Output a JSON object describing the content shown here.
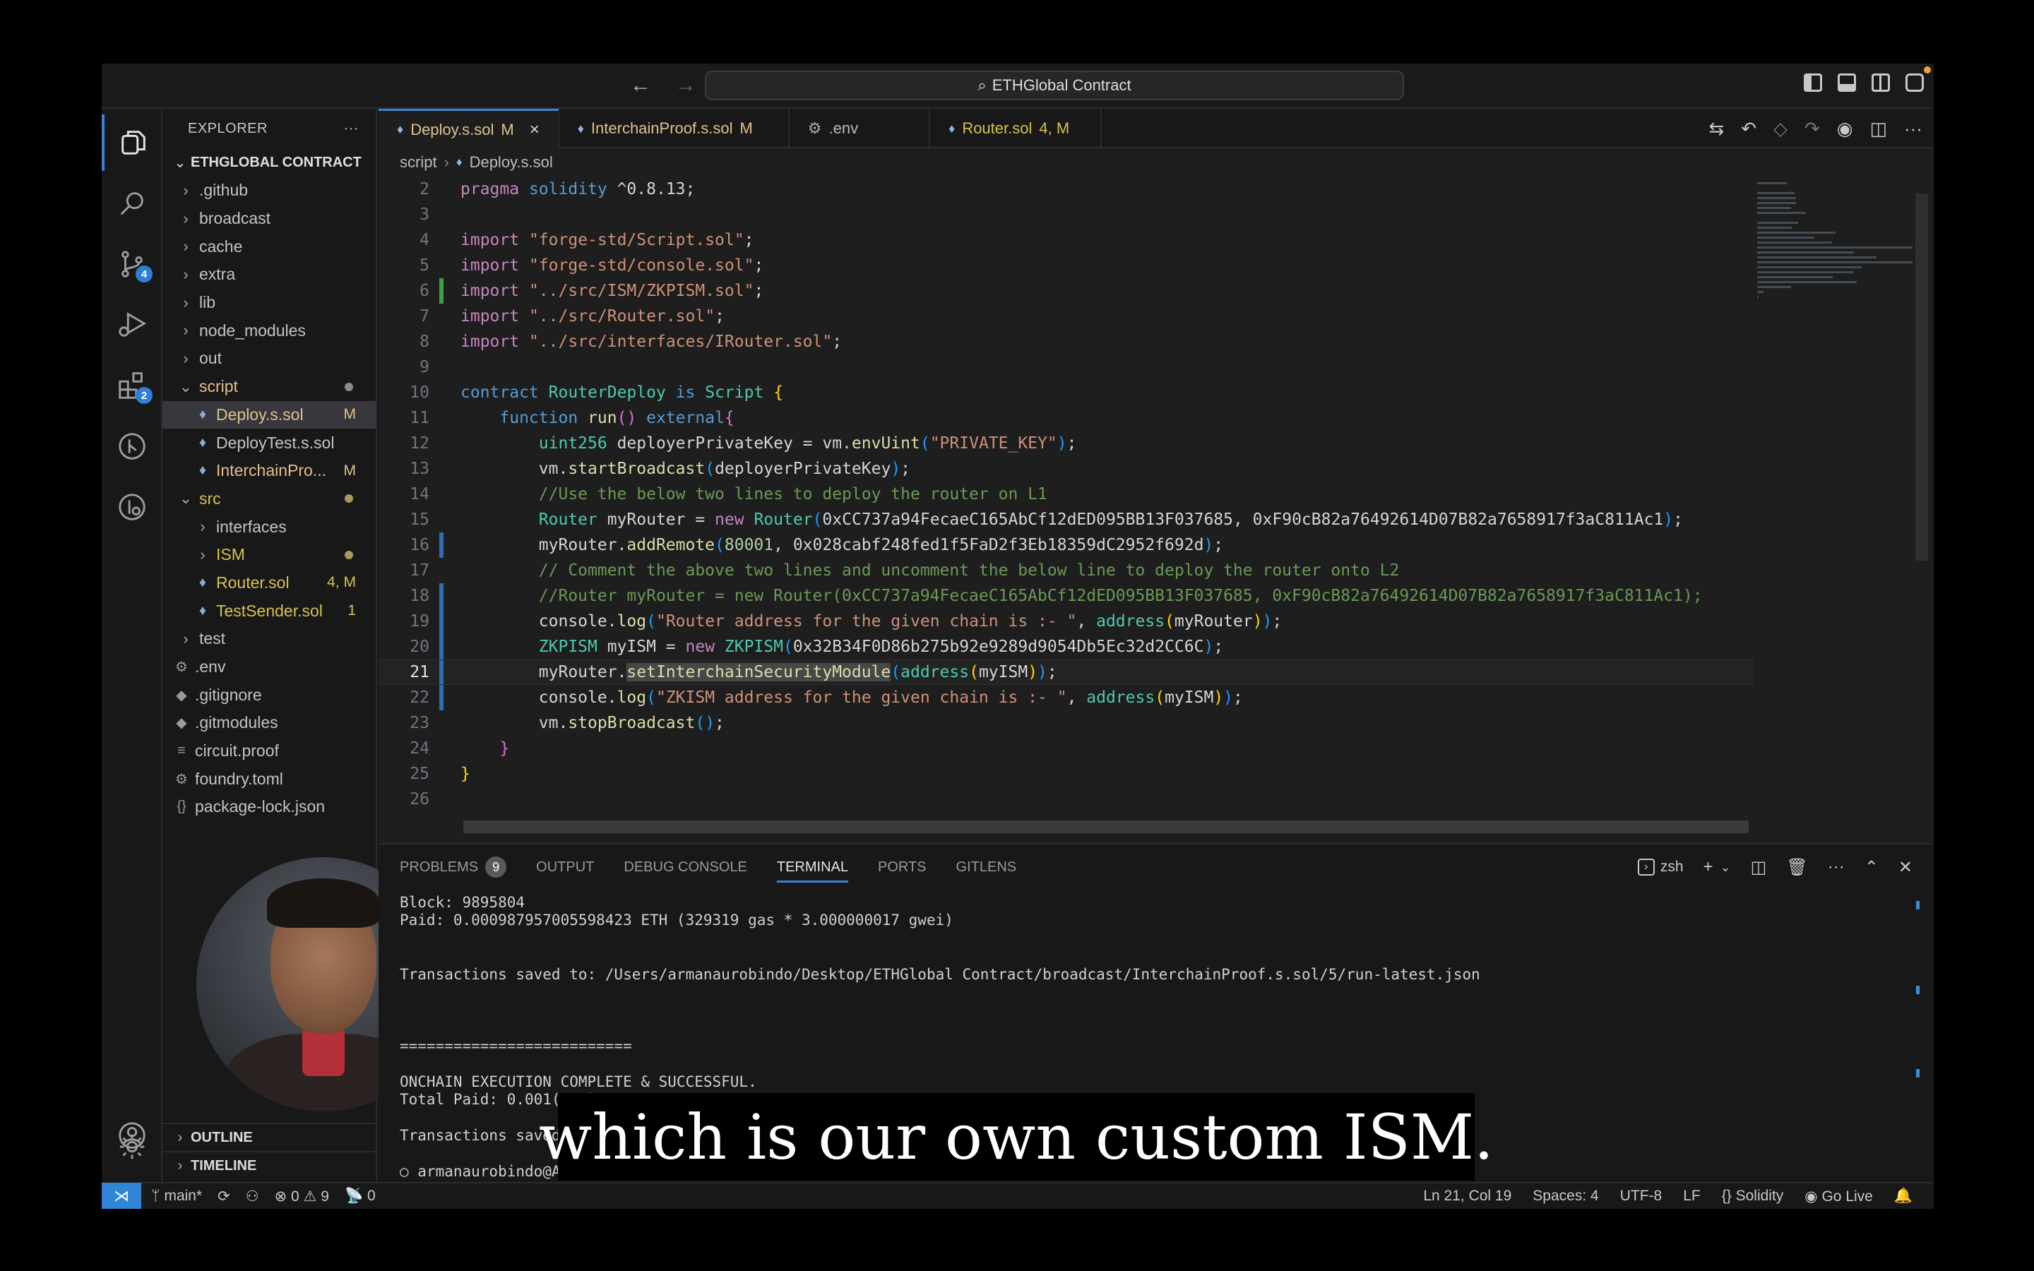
{
  "titlebar": {
    "back_icon": "arrow-left",
    "forward_icon": "arrow-right",
    "search_text": "ETHGlobal Contract",
    "layout_icons": [
      "toggle-primary-sidebar",
      "toggle-panel",
      "toggle-secondary-sidebar",
      "customize-layout"
    ]
  },
  "activity_bar": {
    "items": [
      {
        "name": "explorer",
        "active": true
      },
      {
        "name": "search"
      },
      {
        "name": "source-control",
        "badge": "4"
      },
      {
        "name": "run-and-debug"
      },
      {
        "name": "extensions",
        "badge": "2"
      },
      {
        "name": "gitlens"
      },
      {
        "name": "gitlens-inspect"
      }
    ],
    "bottom": [
      "accounts",
      "manage"
    ]
  },
  "sidebar": {
    "title": "EXPLORER",
    "more": "···",
    "root": "ETHGLOBAL CONTRACT",
    "tree": [
      {
        "label": ".github",
        "type": "folder",
        "depth": 1
      },
      {
        "label": "broadcast",
        "type": "folder",
        "depth": 1
      },
      {
        "label": "cache",
        "type": "folder",
        "depth": 1
      },
      {
        "label": "extra",
        "type": "folder",
        "depth": 1
      },
      {
        "label": "lib",
        "type": "folder",
        "depth": 1
      },
      {
        "label": "node_modules",
        "type": "folder",
        "depth": 1
      },
      {
        "label": "out",
        "type": "folder",
        "depth": 1
      },
      {
        "label": "script",
        "type": "folder-open",
        "depth": 1,
        "dot": true
      },
      {
        "label": "Deploy.s.sol",
        "type": "sol",
        "depth": 2,
        "status": "M",
        "selected": true
      },
      {
        "label": "DeployTest.s.sol",
        "type": "sol",
        "depth": 2
      },
      {
        "label": "InterchainPro...",
        "type": "sol",
        "depth": 2,
        "status": "M"
      },
      {
        "label": "src",
        "type": "folder-open",
        "depth": 1,
        "dot": true
      },
      {
        "label": "interfaces",
        "type": "folder",
        "depth": 2
      },
      {
        "label": "ISM",
        "type": "folder",
        "depth": 2,
        "dot": true
      },
      {
        "label": "Router.sol",
        "type": "sol",
        "depth": 2,
        "status": "4, M"
      },
      {
        "label": "TestSender.sol",
        "type": "sol",
        "depth": 2,
        "status": "1"
      },
      {
        "label": "test",
        "type": "folder",
        "depth": 1
      },
      {
        "label": ".env",
        "type": "gear",
        "depth": 1
      },
      {
        "label": ".gitignore",
        "type": "git",
        "depth": 1
      },
      {
        "label": ".gitmodules",
        "type": "git",
        "depth": 1
      },
      {
        "label": "circuit.proof",
        "type": "text",
        "depth": 1
      },
      {
        "label": "foundry.toml",
        "type": "gear",
        "depth": 1
      },
      {
        "label": "package-lock.json",
        "type": "json",
        "depth": 1
      }
    ],
    "outline": "OUTLINE",
    "timeline": "TIMELINE"
  },
  "editor": {
    "tabs": [
      {
        "label": "Deploy.s.sol",
        "status": "M",
        "active": true,
        "close": "×"
      },
      {
        "label": "InterchainProof.s.sol",
        "status": "M"
      },
      {
        "label": ".env",
        "status": ""
      },
      {
        "label": "Router.sol",
        "status": "4, M"
      }
    ],
    "breadcrumb": [
      "script",
      "Deploy.s.sol"
    ],
    "actions": [
      "open-changes",
      "go-back-change",
      "revision",
      "go-forward-change",
      "gitlens-blame",
      "split-editor",
      "more-actions"
    ],
    "current_line": 21,
    "lines": [
      {
        "n": "2",
        "html": "<span class='kw'>pragma</span> <span class='kw2'>solidity</span> ^0.8.13;"
      },
      {
        "n": "3",
        "html": ""
      },
      {
        "n": "4",
        "html": "<span class='kw'>import</span> <span class='str'>\"forge-std/Script.sol\"</span>;"
      },
      {
        "n": "5",
        "html": "<span class='kw'>import</span> <span class='str'>\"forge-std/console.sol\"</span>;"
      },
      {
        "n": "6",
        "html": "<span class='kw'>import</span> <span class='str'>\"../src/ISM/ZKPISM.sol\"</span>;",
        "gutter": "added"
      },
      {
        "n": "7",
        "html": "<span class='kw'>import</span> <span class='str'>\"../src/Router.sol\"</span>;"
      },
      {
        "n": "8",
        "html": "<span class='kw'>import</span> <span class='str'>\"../src/interfaces/IRouter.sol\"</span>;"
      },
      {
        "n": "9",
        "html": ""
      },
      {
        "n": "10",
        "html": "<span class='kw2'>contract</span> <span class='ty'>RouterDeploy</span> <span class='kw2'>is</span> <span class='ty'>Script</span> <span class='br1'>{</span>"
      },
      {
        "n": "11",
        "html": "    <span class='kw2'>function</span> <span class='fn'>run</span><span class='br2'>()</span> <span class='kw2'>external</span><span class='br2'>{</span>"
      },
      {
        "n": "12",
        "html": "        <span class='ty'>uint256</span> deployerPrivateKey = vm.<span class='fn'>envUint</span><span class='br3'>(</span><span class='str'>\"PRIVATE_KEY\"</span><span class='br3'>)</span>;"
      },
      {
        "n": "13",
        "html": "        vm.<span class='fn'>startBroadcast</span><span class='br3'>(</span>deployerPrivateKey<span class='br3'>)</span>;"
      },
      {
        "n": "14",
        "html": "        <span class='cm'>//Use the below two lines to deploy the router on L1</span>"
      },
      {
        "n": "15",
        "html": "        <span class='ty'>Router</span> myRouter = <span class='kw'>new</span> <span class='ty'>Router</span><span class='br3'>(</span>0xCC737a94FecaeC165AbCf12dED095BB13F037685, 0xF90cB82a76492614D07B82a7658917f3aC811Ac1<span class='br3'>)</span>;"
      },
      {
        "n": "16",
        "html": "        myRouter.<span class='fn'>addRemote</span><span class='br3'>(</span><span class='num'>80001</span>, 0x028cabf248fed1f5FaD2f3Eb18359dC2952f692d<span class='br3'>)</span>;",
        "gutter": "changed"
      },
      {
        "n": "17",
        "html": "        <span class='cm'>// Comment the above two lines and uncomment the below line to deploy the router onto L2</span>"
      },
      {
        "n": "18",
        "html": "        <span class='cm'>//Router myRouter = new Router(0xCC737a94FecaeC165AbCf12dED095BB13F037685, 0xF90cB82a76492614D07B82a7658917f3aC811Ac1);</span>",
        "gutter": "changed"
      },
      {
        "n": "19",
        "html": "        console.<span class='fn'>log</span><span class='br3'>(</span><span class='str'>\"Router address for the given chain is :- \"</span>, <span class='ty'>address</span><span class='br1'>(</span>myRouter<span class='br1'>)</span><span class='br3'>)</span>;",
        "gutter": "changed"
      },
      {
        "n": "20",
        "html": "        <span class='ty'>ZKPISM</span> myISM = <span class='kw'>new</span> <span class='ty'>ZKPISM</span><span class='br3'>(</span>0x32B34F0D86b275b92e9289d9054Db5Ec32d2CC6C<span class='br3'>)</span>;",
        "gutter": "changed"
      },
      {
        "n": "21",
        "html": "        myRouter.<span class='sel'><span class='fn'>setInterchainSecurityModule</span></span><span class='br3'>(</span><span class='ty'>address</span><span class='br1'>(</span>myISM<span class='br1'>)</span><span class='br3'>)</span>;",
        "gutter": "changed"
      },
      {
        "n": "22",
        "html": "        console.<span class='fn'>log</span><span class='br3'>(</span><span class='str'>\"ZKISM address for the given chain is :- \"</span>, <span class='ty'>address</span><span class='br1'>(</span>myISM<span class='br1'>)</span><span class='br3'>)</span>;",
        "gutter": "changed"
      },
      {
        "n": "23",
        "html": "        vm.<span class='fn'>stopBroadcast</span><span class='br3'>()</span>;"
      },
      {
        "n": "24",
        "html": "    <span class='br2'>}</span>"
      },
      {
        "n": "25",
        "html": "<span class='br1'>}</span>"
      },
      {
        "n": "26",
        "html": ""
      }
    ]
  },
  "panel": {
    "tabs": [
      {
        "label": "PROBLEMS",
        "badge": "9"
      },
      {
        "label": "OUTPUT"
      },
      {
        "label": "DEBUG CONSOLE"
      },
      {
        "label": "TERMINAL",
        "active": true
      },
      {
        "label": "PORTS"
      },
      {
        "label": "GITLENS"
      }
    ],
    "shell": "zsh",
    "actions": [
      "new-terminal",
      "terminal-dropdown",
      "split-terminal",
      "kill-terminal",
      "more-actions",
      "maximize-panel",
      "close-panel"
    ],
    "terminal_lines": [
      {
        "text": "Block: 9895804",
        "row": 0
      },
      {
        "text": "Paid: 0.000987957005598423 ETH (329319 gas * 3.000000017 gwei)",
        "row": 1
      },
      {
        "text": "Transactions saved to: /Users/armanaurobindo/Desktop/ETHGlobal Contract/broadcast/InterchainProof.s.sol/5/run-latest.json",
        "row": 4
      },
      {
        "text": "==========================",
        "row": 8
      },
      {
        "text": "ONCHAIN EXECUTION COMPLETE & SUCCESSFUL.",
        "row": 10
      },
      {
        "text": "Total Paid: 0.001(...)",
        "row": 11
      },
      {
        "text": "Transactions saved to: ...",
        "row": 13
      },
      {
        "text": "○ armanaurobindo@Ar...",
        "row": 15
      }
    ]
  },
  "statusbar": {
    "remote_icon": "remote-indicator",
    "branch": "main*",
    "sync_icon": "sync",
    "errors": "0",
    "warnings": "9",
    "ports": "0",
    "cursor": "Ln 21, Col 19",
    "indent": "Spaces: 4",
    "encoding": "UTF-8",
    "eol": "LF",
    "language": "Solidity",
    "golive": "Go Live",
    "bell_icon": "notifications"
  },
  "subtitle": "which is our own custom ISM."
}
